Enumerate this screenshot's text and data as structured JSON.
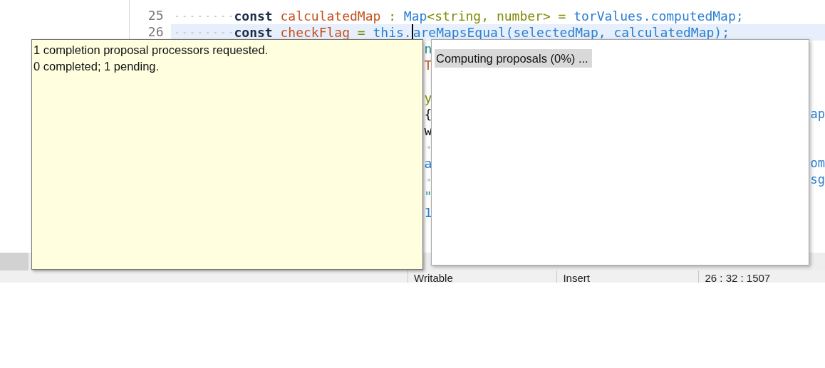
{
  "editor": {
    "lines": [
      {
        "number": "25",
        "current": false,
        "tokens": [
          {
            "text": "const",
            "kind": "keyword"
          },
          {
            "text": "calculatedMap",
            "kind": "variable"
          },
          {
            "text": ":",
            "kind": "operator"
          },
          {
            "text": "Map",
            "kind": "type"
          },
          {
            "text": "<string, number>",
            "kind": "generic"
          },
          {
            "text": "=",
            "kind": "operator"
          },
          {
            "text": "torValues.computedMap;",
            "kind": "member"
          }
        ]
      },
      {
        "number": "26",
        "current": true,
        "tokens": [
          {
            "text": "const",
            "kind": "keyword"
          },
          {
            "text": "checkFlag",
            "kind": "variable"
          },
          {
            "text": "=",
            "kind": "operator"
          },
          {
            "text": "this.",
            "kind": "member",
            "caret": true
          },
          {
            "text": "areMapsEqual(selectedMap, calculatedMap);",
            "kind": "member"
          }
        ]
      }
    ],
    "partial_lines": [
      {
        "kind": "code",
        "left": {
          "text": "n",
          "kind": "teal"
        }
      },
      {
        "kind": "code",
        "left": {
          "text": "T",
          "kind": "variable"
        }
      },
      {
        "kind": "blank"
      },
      {
        "kind": "code",
        "left": {
          "text": "y",
          "kind": "generic"
        }
      },
      {
        "kind": "code",
        "left": {
          "text": "{",
          "kind": "plain"
        },
        "right": {
          "text": "ap",
          "kind": "member"
        }
      },
      {
        "kind": "code",
        "left": {
          "text": "w",
          "kind": "plain"
        }
      },
      {
        "kind": "code",
        "marker": true
      },
      {
        "kind": "code",
        "left": {
          "text": "a",
          "kind": "member"
        },
        "right": {
          "text": "om",
          "kind": "member"
        }
      },
      {
        "kind": "code",
        "marker": true,
        "right": {
          "text": "sg",
          "kind": "member"
        }
      },
      {
        "kind": "code",
        "left": {
          "text": "\"",
          "kind": "teal"
        }
      },
      {
        "kind": "code",
        "left": {
          "text": "1",
          "kind": "member"
        }
      }
    ]
  },
  "tooltip": {
    "lines": [
      "1 completion proposal processors requested.",
      "0 completed; 1 pending."
    ]
  },
  "proposals": {
    "status": "Computing proposals (0%) ..."
  },
  "status_bar": [
    "Writable",
    "Insert",
    "26 : 32 : 1507"
  ]
}
